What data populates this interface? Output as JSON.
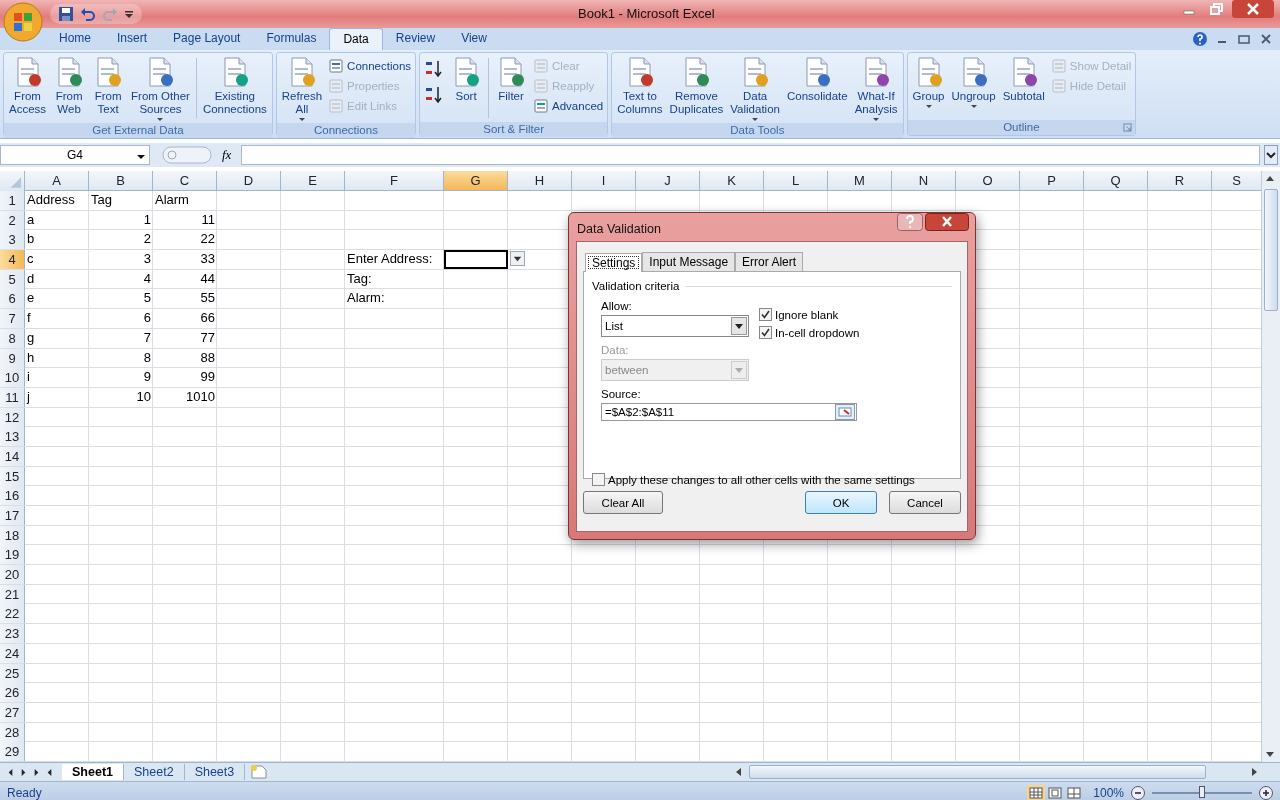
{
  "window": {
    "title": "Book1 - Microsoft Excel"
  },
  "ribbon": {
    "tabs": [
      {
        "label": "Home",
        "selected": false
      },
      {
        "label": "Insert",
        "selected": false
      },
      {
        "label": "Page Layout",
        "selected": false
      },
      {
        "label": "Formulas",
        "selected": false
      },
      {
        "label": "Data",
        "selected": true
      },
      {
        "label": "Review",
        "selected": false
      },
      {
        "label": "View",
        "selected": false
      }
    ],
    "groups": [
      {
        "label": "Get External Data",
        "items": [
          {
            "kind": "large",
            "label": "From\nAccess",
            "dropdown": false,
            "disabled": false
          },
          {
            "kind": "large",
            "label": "From\nWeb",
            "dropdown": false,
            "disabled": false
          },
          {
            "kind": "large",
            "label": "From\nText",
            "dropdown": false,
            "disabled": false
          },
          {
            "kind": "large",
            "label": "From Other\nSources",
            "dropdown": true,
            "disabled": false
          },
          {
            "kind": "separator"
          },
          {
            "kind": "large",
            "label": "Existing\nConnections",
            "dropdown": false,
            "disabled": false
          }
        ]
      },
      {
        "label": "Connections",
        "items": [
          {
            "kind": "large",
            "label": "Refresh\nAll",
            "dropdown": true,
            "disabled": false
          },
          {
            "kind": "stack",
            "items": [
              {
                "kind": "small",
                "label": "Connections",
                "disabled": false
              },
              {
                "kind": "small",
                "label": "Properties",
                "disabled": true
              },
              {
                "kind": "small",
                "label": "Edit Links",
                "disabled": true
              }
            ]
          }
        ]
      },
      {
        "label": "Sort & Filter",
        "items": [
          {
            "kind": "stack",
            "items": [
              {
                "kind": "icon"
              },
              {
                "kind": "icon"
              }
            ]
          },
          {
            "kind": "large",
            "label": "Sort",
            "dropdown": false,
            "disabled": false
          },
          {
            "kind": "separator"
          },
          {
            "kind": "large",
            "label": "Filter",
            "dropdown": false,
            "disabled": false
          },
          {
            "kind": "stack",
            "items": [
              {
                "kind": "small",
                "label": "Clear",
                "disabled": true
              },
              {
                "kind": "small",
                "label": "Reapply",
                "disabled": true
              },
              {
                "kind": "small",
                "label": "Advanced",
                "disabled": false
              }
            ]
          }
        ]
      },
      {
        "label": "Data Tools",
        "items": [
          {
            "kind": "large",
            "label": "Text to\nColumns",
            "dropdown": false,
            "disabled": false
          },
          {
            "kind": "large",
            "label": "Remove\nDuplicates",
            "dropdown": false,
            "disabled": false
          },
          {
            "kind": "large",
            "label": "Data\nValidation",
            "dropdown": true,
            "disabled": false
          },
          {
            "kind": "large",
            "label": "Consolidate",
            "dropdown": false,
            "disabled": false
          },
          {
            "kind": "large",
            "label": "What-If\nAnalysis",
            "dropdown": true,
            "disabled": false
          }
        ]
      },
      {
        "label": "Outline",
        "items": [
          {
            "kind": "large",
            "label": "Group",
            "dropdown": true,
            "disabled": false
          },
          {
            "kind": "large",
            "label": "Ungroup",
            "dropdown": true,
            "disabled": false
          },
          {
            "kind": "large",
            "label": "Subtotal",
            "dropdown": false,
            "disabled": false
          },
          {
            "kind": "stack",
            "items": [
              {
                "kind": "small",
                "label": "Show Detail",
                "disabled": true
              },
              {
                "kind": "small",
                "label": "Hide Detail",
                "disabled": true
              }
            ]
          }
        ]
      }
    ]
  },
  "formula_bar": {
    "name_box": "G4",
    "function_label": "fx"
  },
  "sheet": {
    "columns": [
      {
        "label": "A",
        "selected": false
      },
      {
        "label": "B",
        "selected": false
      },
      {
        "label": "C",
        "selected": false
      },
      {
        "label": "D",
        "selected": false
      },
      {
        "label": "E",
        "selected": false
      },
      {
        "label": "F",
        "selected": false
      },
      {
        "label": "G",
        "selected": true
      },
      {
        "label": "H",
        "selected": false
      },
      {
        "label": "I",
        "selected": false
      },
      {
        "label": "J",
        "selected": false
      },
      {
        "label": "K",
        "selected": false
      },
      {
        "label": "L",
        "selected": false
      },
      {
        "label": "M",
        "selected": false
      },
      {
        "label": "N",
        "selected": false
      },
      {
        "label": "O",
        "selected": false
      },
      {
        "label": "P",
        "selected": false
      },
      {
        "label": "Q",
        "selected": false
      },
      {
        "label": "R",
        "selected": false
      },
      {
        "label": "S",
        "selected": false
      }
    ],
    "rows": [
      {
        "header": "1",
        "selected": false,
        "kind": "header",
        "col_a": "Address",
        "col_b": "Tag",
        "col_c": "Alarm"
      },
      {
        "header": "2",
        "selected": false,
        "kind": "data",
        "col_a": "a",
        "col_b": "1",
        "col_c": "11"
      },
      {
        "header": "3",
        "selected": false,
        "kind": "data",
        "col_a": "b",
        "col_b": "2",
        "col_c": "22"
      },
      {
        "header": "4",
        "selected": true,
        "kind": "data",
        "col_a": "c",
        "col_b": "3",
        "col_c": "33",
        "col_f": "Enter Address:"
      },
      {
        "header": "5",
        "selected": false,
        "kind": "data",
        "col_a": "d",
        "col_b": "4",
        "col_c": "44",
        "col_f": "Tag:"
      },
      {
        "header": "6",
        "selected": false,
        "kind": "data",
        "col_a": "e",
        "col_b": "5",
        "col_c": "55",
        "col_f": "Alarm:"
      },
      {
        "header": "7",
        "selected": false,
        "kind": "data",
        "col_a": "f",
        "col_b": "6",
        "col_c": "66"
      },
      {
        "header": "8",
        "selected": false,
        "kind": "data",
        "col_a": "g",
        "col_b": "7",
        "col_c": "77"
      },
      {
        "header": "9",
        "selected": false,
        "kind": "data",
        "col_a": "h",
        "col_b": "8",
        "col_c": "88"
      },
      {
        "header": "10",
        "selected": false,
        "kind": "data",
        "col_a": "i",
        "col_b": "9",
        "col_c": "99"
      },
      {
        "header": "11",
        "selected": false,
        "kind": "data",
        "col_a": "j",
        "col_b": "10",
        "col_c": "1010"
      },
      {
        "header": "12",
        "selected": false
      },
      {
        "header": "13",
        "selected": false
      },
      {
        "header": "14",
        "selected": false
      },
      {
        "header": "15",
        "selected": false
      },
      {
        "header": "16",
        "selected": false
      },
      {
        "header": "17",
        "selected": false
      },
      {
        "header": "18",
        "selected": false
      },
      {
        "header": "19",
        "selected": false
      },
      {
        "header": "20",
        "selected": false
      },
      {
        "header": "21",
        "selected": false
      },
      {
        "header": "22",
        "selected": false
      },
      {
        "header": "23",
        "selected": false
      },
      {
        "header": "24",
        "selected": false
      },
      {
        "header": "25",
        "selected": false
      },
      {
        "header": "26",
        "selected": false
      },
      {
        "header": "27",
        "selected": false
      },
      {
        "header": "28",
        "selected": false
      },
      {
        "header": "29",
        "selected": false
      }
    ]
  },
  "dialog": {
    "title": "Data Validation",
    "tabs": [
      {
        "label": "Settings",
        "selected": true
      },
      {
        "label": "Input Message",
        "selected": false
      },
      {
        "label": "Error Alert",
        "selected": false
      }
    ],
    "section": "Validation criteria",
    "allow": {
      "label": "Allow:",
      "value": "List",
      "disabled": false
    },
    "data": {
      "label": "Data:",
      "value": "between",
      "disabled": true
    },
    "options": [
      {
        "label": "Ignore blank",
        "checked": true
      },
      {
        "label": "In-cell dropdown",
        "checked": true
      }
    ],
    "source": {
      "label": "Source:",
      "value": "=$A$2:$A$11"
    },
    "apply": {
      "label": "Apply these changes to all other cells with the same settings",
      "checked": false
    },
    "buttons": [
      {
        "label": "Clear All",
        "kind": "left"
      },
      {
        "label": "OK",
        "kind": "default"
      },
      {
        "label": "Cancel",
        "kind": "normal"
      }
    ]
  },
  "sheet_tabs": [
    {
      "label": "Sheet1",
      "selected": true
    },
    {
      "label": "Sheet2",
      "selected": false
    },
    {
      "label": "Sheet3",
      "selected": false
    }
  ],
  "status_bar": {
    "status": "Ready",
    "zoom": {
      "reading": "100%",
      "level": 0.5
    }
  }
}
